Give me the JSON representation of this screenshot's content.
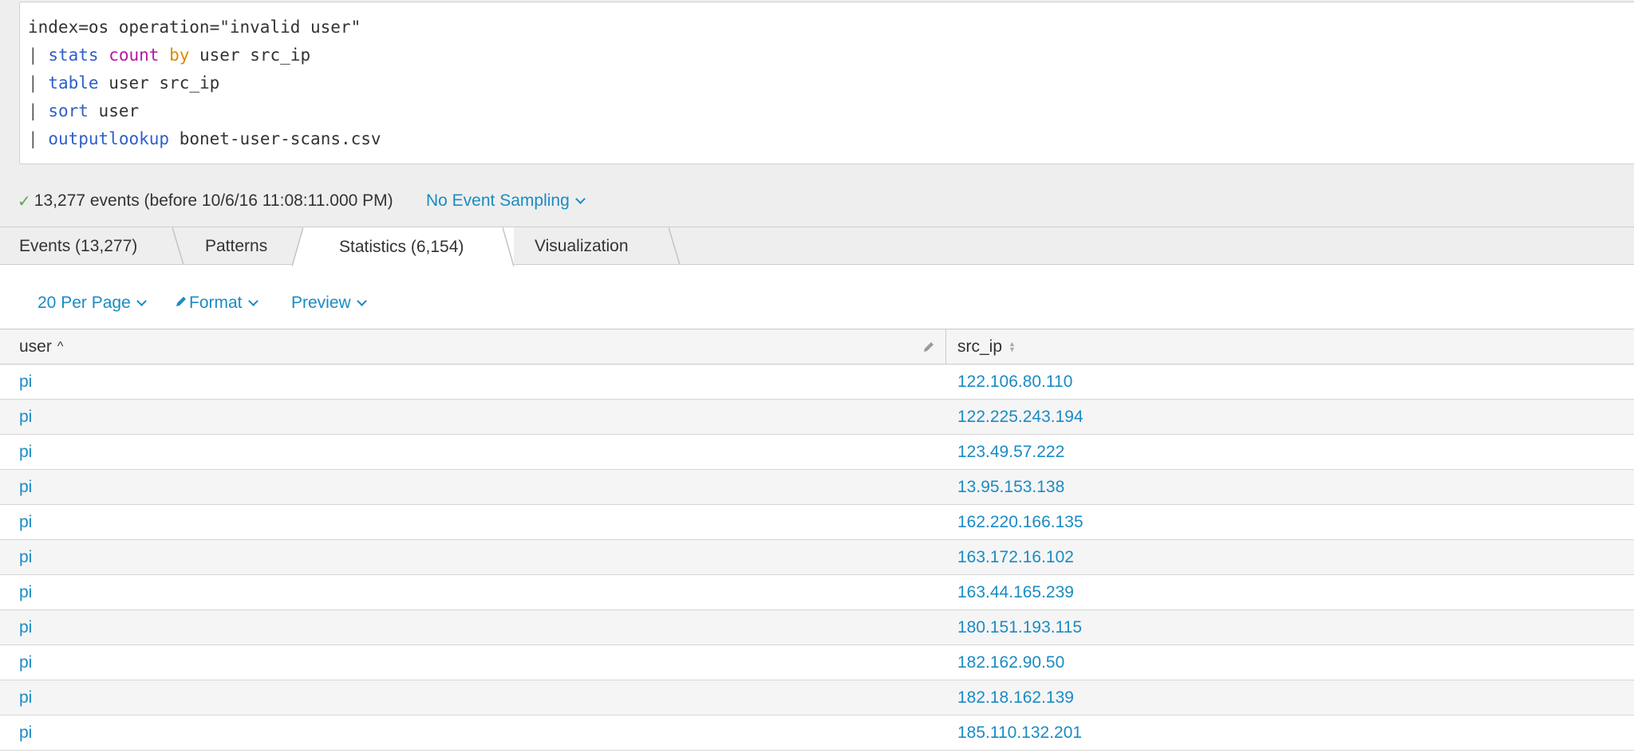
{
  "query": {
    "line1": "index=os operation=\"invalid user\"",
    "line2": {
      "pipe": "|",
      "cmd": "stats",
      "fn": "count",
      "kw": "by",
      "rest": "user src_ip"
    },
    "line3": {
      "pipe": "|",
      "cmd": "table",
      "rest": "user src_ip"
    },
    "line4": {
      "pipe": "|",
      "cmd": "sort",
      "rest": "user"
    },
    "line5": {
      "pipe": "|",
      "cmd": "outputlookup",
      "rest": "bonet-user-scans.csv"
    }
  },
  "status": {
    "summary": "13,277 events (before 10/6/16 11:08:11.000 PM)",
    "sampling": "No Event Sampling"
  },
  "tabs": [
    {
      "label": "Events (13,277)",
      "active": false
    },
    {
      "label": "Patterns",
      "active": false
    },
    {
      "label": "Statistics (6,154)",
      "active": true
    },
    {
      "label": "Visualization",
      "active": false
    }
  ],
  "toolbar": {
    "per_page": "20 Per Page",
    "format": "Format",
    "preview": "Preview"
  },
  "table": {
    "columns": [
      "user",
      "src_ip"
    ],
    "rows": [
      {
        "user": "pi",
        "src_ip": "122.106.80.110"
      },
      {
        "user": "pi",
        "src_ip": "122.225.243.194"
      },
      {
        "user": "pi",
        "src_ip": "123.49.57.222"
      },
      {
        "user": "pi",
        "src_ip": "13.95.153.138"
      },
      {
        "user": "pi",
        "src_ip": "162.220.166.135"
      },
      {
        "user": "pi",
        "src_ip": "163.172.16.102"
      },
      {
        "user": "pi",
        "src_ip": "163.44.165.239"
      },
      {
        "user": "pi",
        "src_ip": "180.151.193.115"
      },
      {
        "user": "pi",
        "src_ip": "182.162.90.50"
      },
      {
        "user": "pi",
        "src_ip": "182.18.162.139"
      },
      {
        "user": "pi",
        "src_ip": "185.110.132.201"
      }
    ]
  },
  "colors": {
    "link": "#1a8bc4",
    "cmd": "#2f5fc8",
    "function": "#b5179e",
    "keyword": "#e08a00",
    "check": "#5aa64d"
  }
}
